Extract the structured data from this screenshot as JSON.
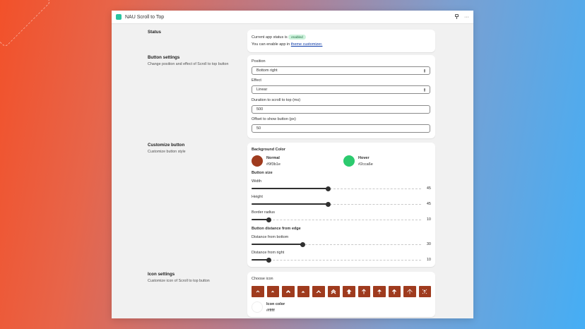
{
  "window": {
    "title": "NAU Scroll to Top",
    "app_icon_color": "#2bc4a0",
    "more_label": "···"
  },
  "status": {
    "title": "Status",
    "status_prefix": "Current app status is",
    "status_badge": "enabled",
    "enable_prefix": "You can enable app in",
    "enable_link": "theme customizer."
  },
  "button_settings": {
    "title": "Button settings",
    "description": "Change position and effect of Scroll to top button",
    "position_label": "Position",
    "position_value": "Bottom right",
    "effect_label": "Effect",
    "effect_value": "Linear",
    "duration_label": "Duration to scroll to top (ms)",
    "duration_value": "500",
    "offset_label": "Offset to show button (px)",
    "offset_value": "50"
  },
  "customize": {
    "title": "Customize button",
    "description": "Customize button style",
    "bg_color_label": "Background Color",
    "normal_label": "Normal",
    "normal_value": "#9f3b1e",
    "hover_label": "Hover",
    "hover_value": "#2cca6e",
    "size_label": "Button size",
    "width_label": "Width",
    "width_value": 45,
    "height_label": "Height",
    "height_value": 45,
    "radius_label": "Border radius",
    "radius_value": 10,
    "distance_label": "Button distance from edge",
    "bottom_label": "Distance from bottom",
    "bottom_value": 30,
    "right_label": "Distance from right",
    "right_value": 10,
    "slider_max": 100
  },
  "icon_settings": {
    "title": "Icon settings",
    "description": "Customize icon of Scroll to top button",
    "choose_label": "Choose icon",
    "icons": [
      "chevron-up-icon",
      "chevron-up-small-icon",
      "chevron-up-bold-icon",
      "triangle-up-icon",
      "triangle-up-large-icon",
      "double-chevron-up-icon",
      "bold-arrow-up-icon",
      "arrow-up-icon",
      "arrow-up-thin-icon",
      "arrow-up-bar-icon",
      "arrow-up-circle-icon",
      "arrow-up-sun-icon"
    ],
    "tile_color": "#9f3b1e",
    "icon_color_label": "Icon color",
    "icon_color_value": "#ffffff"
  }
}
